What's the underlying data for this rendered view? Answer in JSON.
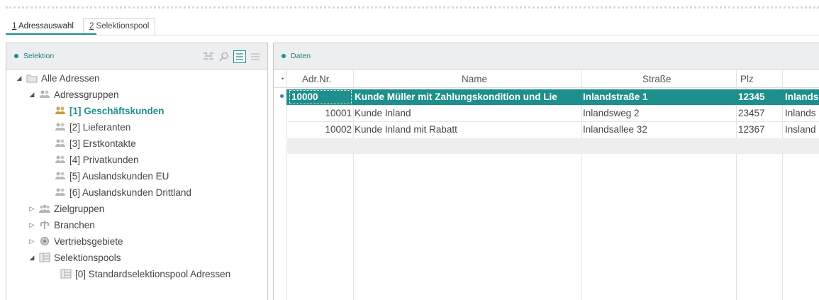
{
  "tabs": [
    {
      "key": "1",
      "rest": " Adressauswahl",
      "active": true
    },
    {
      "key": "2",
      "rest": " Selektionspool",
      "active": false
    }
  ],
  "left_panel": {
    "title": "Selektion",
    "tools": [
      "filter-icon",
      "search-icon",
      "list-icon",
      "menu-icon"
    ],
    "tree": [
      {
        "label": "Alle Adressen",
        "icon": "folder-open-icon"
      },
      {
        "label": "Adressgruppen",
        "icon": "people-icon"
      },
      {
        "label": "[1] Geschäftskunden",
        "icon": "people-icon"
      },
      {
        "label": "[2] Lieferanten",
        "icon": "people-icon"
      },
      {
        "label": "[3] Erstkontakte",
        "icon": "people-icon"
      },
      {
        "label": "[4] Privatkunden",
        "icon": "people-icon"
      },
      {
        "label": "[5] Auslandskunden EU",
        "icon": "people-icon"
      },
      {
        "label": "[6] Auslandskunden Drittland",
        "icon": "people-icon"
      },
      {
        "label": "Zielgruppen",
        "icon": "group-icon"
      },
      {
        "label": "Branchen",
        "icon": "branch-icon"
      },
      {
        "label": "Vertriebsgebiete",
        "icon": "region-icon"
      },
      {
        "label": "Selektionspools",
        "icon": "pool-icon"
      },
      {
        "label": "[0] Standardselektionspool Adressen",
        "icon": "pool-icon"
      }
    ]
  },
  "right_panel": {
    "title": "Daten",
    "columns": {
      "nr": "Adr.Nr.",
      "name": "Name",
      "street": "Straße",
      "plz": "Plz"
    },
    "rows": [
      {
        "nr": "10000",
        "name": "Kunde Müller mit Zahlungskondition und Lie",
        "street": "Inlandstraße 1",
        "plz": "12345",
        "extra": "Inlands"
      },
      {
        "nr": "10001",
        "name": "Kunde Inland",
        "street": "Inlandsweg 2",
        "plz": "23457",
        "extra": "Inlands"
      },
      {
        "nr": "10002",
        "name": "Kunde Inland mit Rabatt",
        "street": "Inlandsallee 32",
        "plz": "12367",
        "extra": "Insland"
      }
    ]
  },
  "colors": {
    "accent": "#1e8f8c",
    "panel_head": "#eceeef",
    "border": "#c9c9c9"
  }
}
